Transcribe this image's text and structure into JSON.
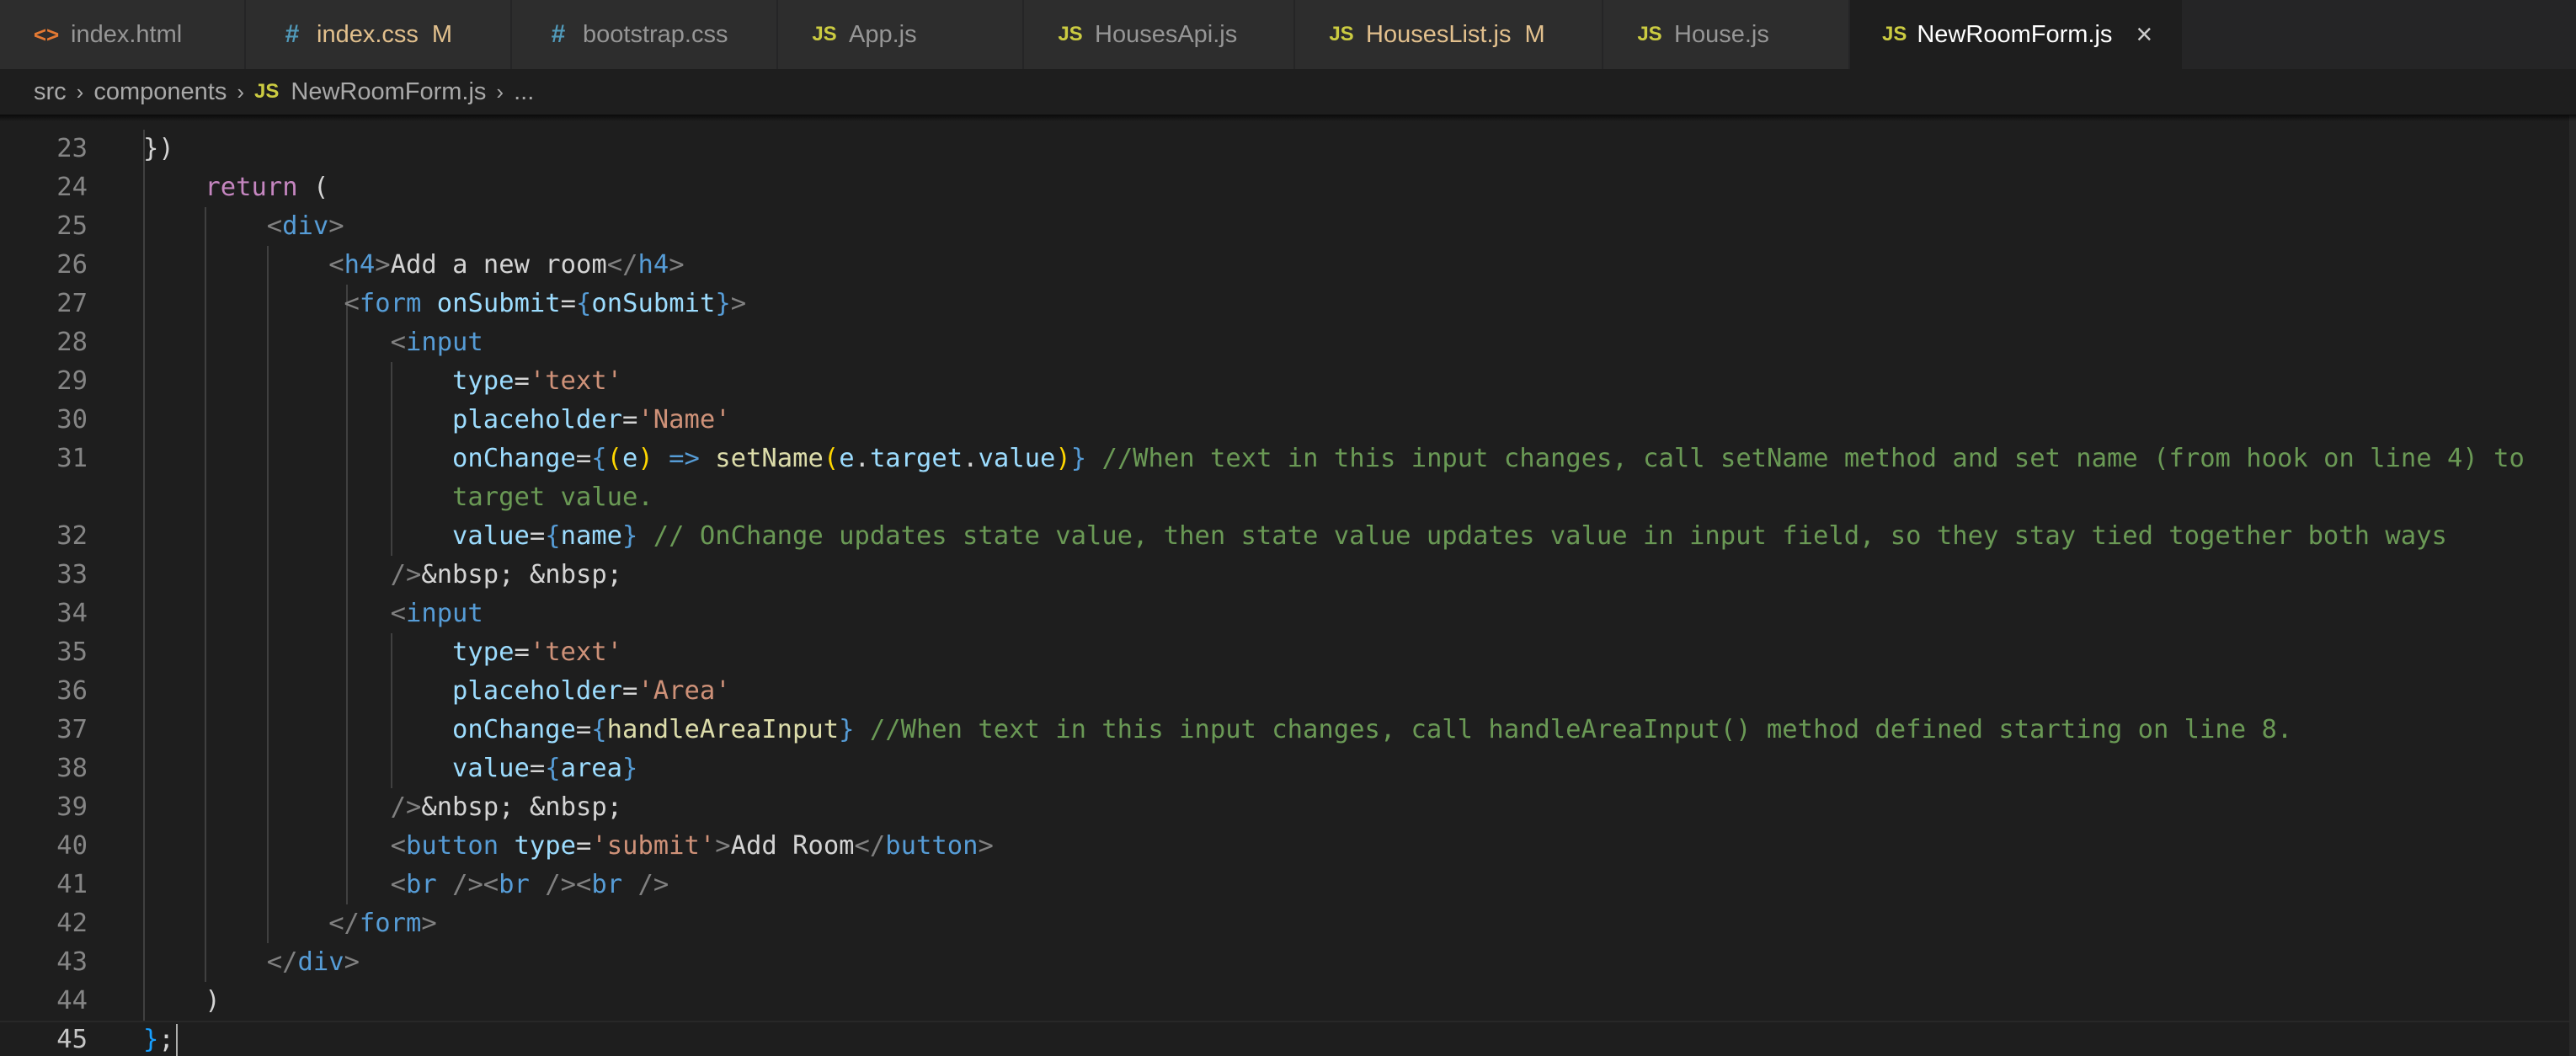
{
  "tabs": [
    {
      "icon": "html-file-icon",
      "glyph": "<>",
      "label": "index.html",
      "badge": ""
    },
    {
      "icon": "css-file-icon",
      "glyph": "#",
      "label": "index.css",
      "badge": "M"
    },
    {
      "icon": "css-file-icon",
      "glyph": "#",
      "label": "bootstrap.css",
      "badge": ""
    },
    {
      "icon": "js-file-icon",
      "glyph": "JS",
      "label": "App.js",
      "badge": ""
    },
    {
      "icon": "js-file-icon",
      "glyph": "JS",
      "label": "HousesApi.js",
      "badge": ""
    },
    {
      "icon": "js-file-icon",
      "glyph": "JS",
      "label": "HousesList.js",
      "badge": "M"
    },
    {
      "icon": "js-file-icon",
      "glyph": "JS",
      "label": "House.js",
      "badge": ""
    },
    {
      "icon": "js-file-icon",
      "glyph": "JS",
      "label": "NewRoomForm.js",
      "badge": "",
      "active": true
    }
  ],
  "breadcrumb": {
    "folder1": "src",
    "folder2": "components",
    "file": "NewRoomForm.js",
    "js_glyph": "JS",
    "more": "..."
  },
  "editor": {
    "partial_top": "})",
    "line_numbers": [
      "23",
      "24",
      "25",
      "26",
      "27",
      "28",
      "29",
      "30",
      "31",
      "",
      "32",
      "33",
      "34",
      "35",
      "36",
      "37",
      "38",
      "39",
      "40",
      "41",
      "42",
      "43",
      "44",
      "45"
    ],
    "lines": [
      [],
      [
        {
          "k": "kw",
          "t": "return"
        },
        {
          "k": "pun",
          "t": " ("
        }
      ],
      [
        {
          "k": "tgb",
          "t": "<"
        },
        {
          "k": "tg",
          "t": "div"
        },
        {
          "k": "tgb",
          "t": ">"
        }
      ],
      [
        {
          "k": "tgb",
          "t": "<"
        },
        {
          "k": "tg",
          "t": "h4"
        },
        {
          "k": "tgb",
          "t": ">"
        },
        {
          "k": "tx",
          "t": "Add a new room"
        },
        {
          "k": "tgb",
          "t": "</"
        },
        {
          "k": "tg",
          "t": "h4"
        },
        {
          "k": "tgb",
          "t": ">"
        }
      ],
      [
        {
          "k": "tgb",
          "t": "<"
        },
        {
          "k": "tg",
          "t": "form"
        },
        {
          "k": "tx",
          "t": " "
        },
        {
          "k": "at",
          "t": "onSubmit"
        },
        {
          "k": "pun",
          "t": "="
        },
        {
          "k": "tg",
          "t": "{"
        },
        {
          "k": "vr",
          "t": "onSubmit"
        },
        {
          "k": "tg",
          "t": "}"
        },
        {
          "k": "tgb",
          "t": ">"
        }
      ],
      [
        {
          "k": "tgb",
          "t": "<"
        },
        {
          "k": "tg",
          "t": "input"
        }
      ],
      [
        {
          "k": "at",
          "t": "type"
        },
        {
          "k": "pun",
          "t": "="
        },
        {
          "k": "st",
          "t": "'text'"
        }
      ],
      [
        {
          "k": "at",
          "t": "placeholder"
        },
        {
          "k": "pun",
          "t": "="
        },
        {
          "k": "st",
          "t": "'Name'"
        }
      ],
      [
        {
          "k": "at",
          "t": "onChange"
        },
        {
          "k": "pun",
          "t": "="
        },
        {
          "k": "tg",
          "t": "{"
        },
        {
          "k": "br2",
          "t": "("
        },
        {
          "k": "vr",
          "t": "e"
        },
        {
          "k": "br2",
          "t": ")"
        },
        {
          "k": "tx",
          "t": " "
        },
        {
          "k": "tg",
          "t": "=>"
        },
        {
          "k": "tx",
          "t": " "
        },
        {
          "k": "fn",
          "t": "setName"
        },
        {
          "k": "br2",
          "t": "("
        },
        {
          "k": "vr",
          "t": "e"
        },
        {
          "k": "pun",
          "t": "."
        },
        {
          "k": "vr",
          "t": "target"
        },
        {
          "k": "pun",
          "t": "."
        },
        {
          "k": "vr",
          "t": "value"
        },
        {
          "k": "br2",
          "t": ")"
        },
        {
          "k": "tg",
          "t": "}"
        },
        {
          "k": "tx",
          "t": " "
        },
        {
          "k": "cm",
          "t": "//When text in this input changes, call setName method and set name (from hook on line 4) to"
        }
      ],
      [
        {
          "k": "cm",
          "t": "target value."
        }
      ],
      [
        {
          "k": "at",
          "t": "value"
        },
        {
          "k": "pun",
          "t": "="
        },
        {
          "k": "tg",
          "t": "{"
        },
        {
          "k": "vr",
          "t": "name"
        },
        {
          "k": "tg",
          "t": "}"
        },
        {
          "k": "tx",
          "t": " "
        },
        {
          "k": "cm",
          "t": "// OnChange updates state value, then state value updates value in input field, so they stay tied together both ways"
        }
      ],
      [
        {
          "k": "tgb",
          "t": "/>"
        },
        {
          "k": "tx",
          "t": "&nbsp; &nbsp;"
        }
      ],
      [
        {
          "k": "tgb",
          "t": "<"
        },
        {
          "k": "tg",
          "t": "input"
        }
      ],
      [
        {
          "k": "at",
          "t": "type"
        },
        {
          "k": "pun",
          "t": "="
        },
        {
          "k": "st",
          "t": "'text'"
        }
      ],
      [
        {
          "k": "at",
          "t": "placeholder"
        },
        {
          "k": "pun",
          "t": "="
        },
        {
          "k": "st",
          "t": "'Area'"
        }
      ],
      [
        {
          "k": "at",
          "t": "onChange"
        },
        {
          "k": "pun",
          "t": "="
        },
        {
          "k": "tg",
          "t": "{"
        },
        {
          "k": "fn",
          "t": "handleAreaInput"
        },
        {
          "k": "tg",
          "t": "}"
        },
        {
          "k": "tx",
          "t": " "
        },
        {
          "k": "cm",
          "t": "//When text in this input changes, call handleAreaInput() method defined starting on line 8."
        }
      ],
      [
        {
          "k": "at",
          "t": "value"
        },
        {
          "k": "pun",
          "t": "="
        },
        {
          "k": "tg",
          "t": "{"
        },
        {
          "k": "vr",
          "t": "area"
        },
        {
          "k": "tg",
          "t": "}"
        }
      ],
      [
        {
          "k": "tgb",
          "t": "/>"
        },
        {
          "k": "tx",
          "t": "&nbsp; &nbsp;"
        }
      ],
      [
        {
          "k": "tgb",
          "t": "<"
        },
        {
          "k": "tg",
          "t": "button"
        },
        {
          "k": "tx",
          "t": " "
        },
        {
          "k": "at",
          "t": "type"
        },
        {
          "k": "pun",
          "t": "="
        },
        {
          "k": "st",
          "t": "'submit'"
        },
        {
          "k": "tgb",
          "t": ">"
        },
        {
          "k": "tx",
          "t": "Add Room"
        },
        {
          "k": "tgb",
          "t": "</"
        },
        {
          "k": "tg",
          "t": "button"
        },
        {
          "k": "tgb",
          "t": ">"
        }
      ],
      [
        {
          "k": "tgb",
          "t": "<"
        },
        {
          "k": "tg",
          "t": "br"
        },
        {
          "k": "tx",
          "t": " "
        },
        {
          "k": "tgb",
          "t": "/><"
        },
        {
          "k": "tg",
          "t": "br"
        },
        {
          "k": "tx",
          "t": " "
        },
        {
          "k": "tgb",
          "t": "/><"
        },
        {
          "k": "tg",
          "t": "br"
        },
        {
          "k": "tx",
          "t": " "
        },
        {
          "k": "tgb",
          "t": "/>"
        }
      ],
      [
        {
          "k": "tgb",
          "t": "</"
        },
        {
          "k": "tg",
          "t": "form"
        },
        {
          "k": "tgb",
          "t": ">"
        }
      ],
      [
        {
          "k": "tgb",
          "t": "</"
        },
        {
          "k": "tg",
          "t": "div"
        },
        {
          "k": "tgb",
          "t": ">"
        }
      ],
      [
        {
          "k": "pun",
          "t": ")"
        }
      ],
      [
        {
          "k": "br",
          "t": "}"
        },
        {
          "k": "pun",
          "t": ";"
        }
      ]
    ]
  },
  "colors": {
    "editor_bg": "#1e1e1e",
    "tab_inactive_bg": "#2d2d2d",
    "keyword": "#c586c0",
    "tag": "#569cd6",
    "attribute": "#9cdcfe",
    "string": "#ce9178",
    "function": "#dcdcaa",
    "comment": "#6a9955",
    "modified": "#e2c08d"
  }
}
